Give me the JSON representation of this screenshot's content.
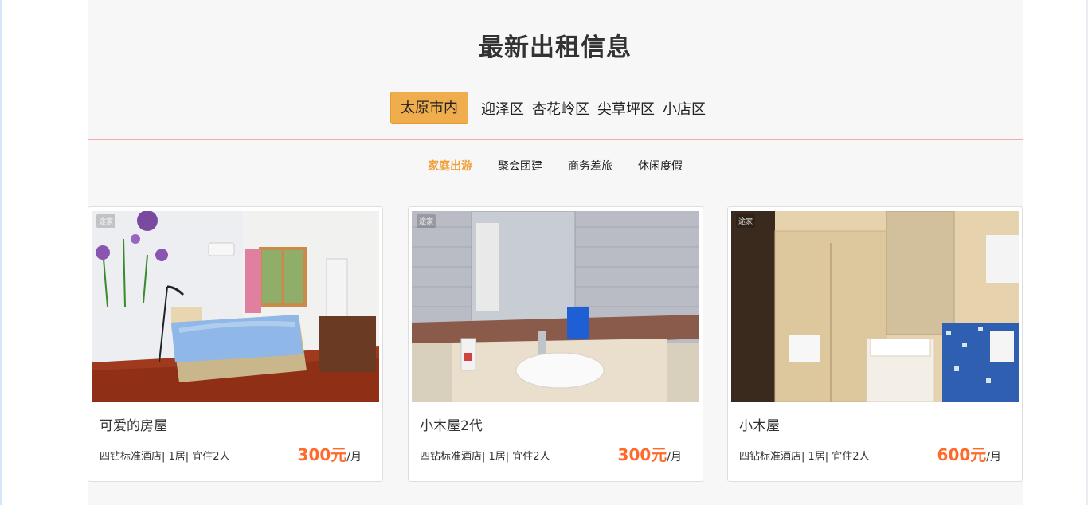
{
  "section": {
    "title": "最新出租信息"
  },
  "districts": [
    "太原市内",
    "迎泽区",
    "杏花岭区",
    "尖草坪区",
    "小店区"
  ],
  "categories": [
    "家庭出游",
    "聚会团建",
    "商务差旅",
    "休闲度假"
  ],
  "listings": [
    {
      "watermark": "途家",
      "name": "可爱的房屋",
      "meta": "四钻标准酒店| 1居| 宜住2人",
      "price": "300元",
      "unit": "/月"
    },
    {
      "watermark": "途家",
      "name": "小木屋2代",
      "meta": "四钻标准酒店| 1居| 宜住2人",
      "price": "300元",
      "unit": "/月"
    },
    {
      "watermark": "途家",
      "name": "小木屋",
      "meta": "四钻标准酒店| 1居| 宜住2人",
      "price": "600元",
      "unit": "/月"
    }
  ],
  "colors": {
    "accent": "#f0ad4e",
    "price": "#ff6a2a",
    "divider": "#f2a9a9",
    "active_category": "#f0a23e"
  }
}
